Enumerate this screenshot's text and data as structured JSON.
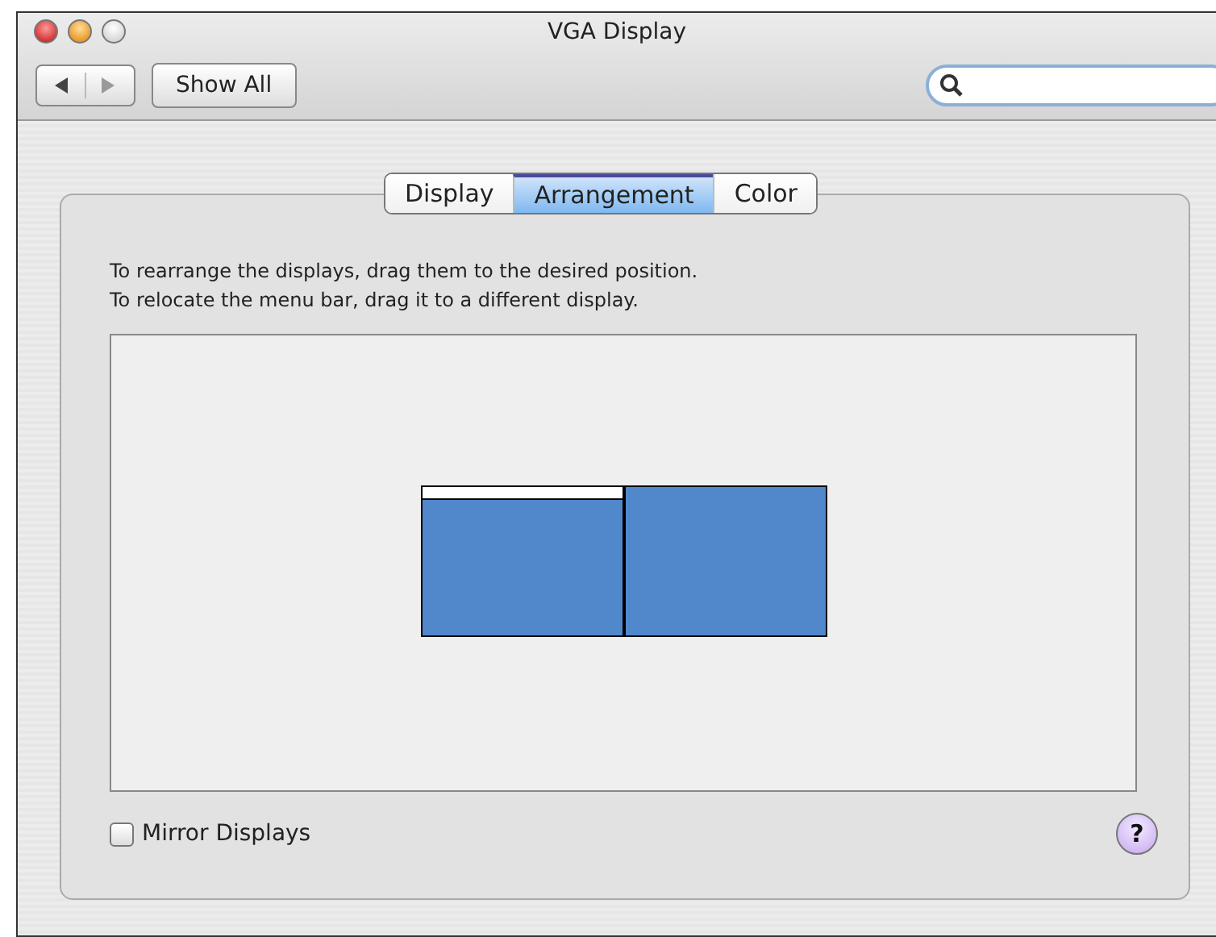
{
  "window": {
    "title": "VGA Display"
  },
  "toolbar": {
    "show_all": "Show All"
  },
  "tabs": [
    {
      "label": "Display",
      "selected": false
    },
    {
      "label": "Arrangement",
      "selected": true
    },
    {
      "label": "Color",
      "selected": false
    }
  ],
  "instructions": [
    "To rearrange the displays, drag them to the desired position.",
    "To relocate the menu bar, drag it to a different display."
  ],
  "displays": [
    {
      "menu_bar": true
    },
    {
      "menu_bar": false
    }
  ],
  "mirror_displays": {
    "label": "Mirror Displays",
    "checked": false
  },
  "help": "?"
}
